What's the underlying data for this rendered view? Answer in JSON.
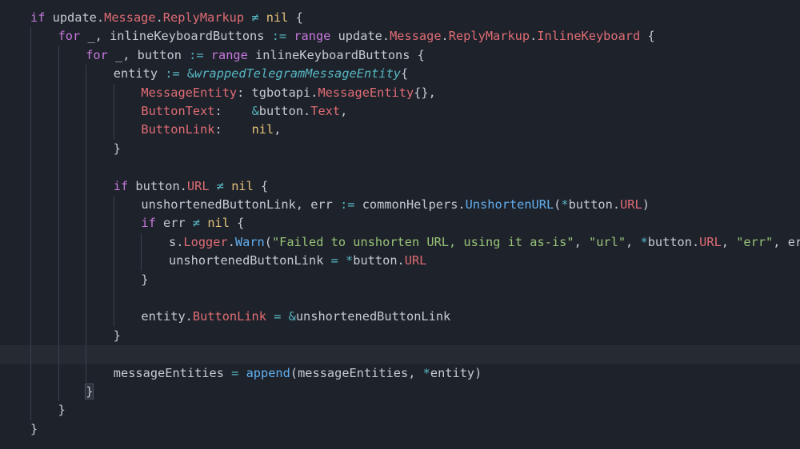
{
  "editor": {
    "lines": [
      {
        "indent": 0,
        "current": false,
        "tokens": [
          {
            "t": "if",
            "c": "kw"
          },
          {
            "t": " update.",
            "c": "nm"
          },
          {
            "t": "Message",
            "c": "ty"
          },
          {
            "t": ".",
            "c": "nm"
          },
          {
            "t": "ReplyMarkup",
            "c": "ty"
          },
          {
            "t": " ≠ ",
            "c": "op"
          },
          {
            "t": "nil",
            "c": "nl"
          },
          {
            "t": " {",
            "c": "pu"
          }
        ]
      },
      {
        "indent": 1,
        "current": false,
        "tokens": [
          {
            "t": "for",
            "c": "kw"
          },
          {
            "t": " _, inlineKeyboardButtons ",
            "c": "nm"
          },
          {
            "t": ":=",
            "c": "op"
          },
          {
            "t": " ",
            "c": "nm"
          },
          {
            "t": "range",
            "c": "kw"
          },
          {
            "t": " update.",
            "c": "nm"
          },
          {
            "t": "Message",
            "c": "ty"
          },
          {
            "t": ".",
            "c": "nm"
          },
          {
            "t": "ReplyMarkup",
            "c": "ty"
          },
          {
            "t": ".",
            "c": "nm"
          },
          {
            "t": "InlineKeyboard",
            "c": "ty"
          },
          {
            "t": " {",
            "c": "pu"
          }
        ]
      },
      {
        "indent": 2,
        "current": false,
        "tokens": [
          {
            "t": "for",
            "c": "kw"
          },
          {
            "t": " _, button ",
            "c": "nm"
          },
          {
            "t": ":=",
            "c": "op"
          },
          {
            "t": " ",
            "c": "nm"
          },
          {
            "t": "range",
            "c": "kw"
          },
          {
            "t": " inlineKeyboardButtons ",
            "c": "nm"
          },
          {
            "t": "{",
            "c": "pu"
          }
        ]
      },
      {
        "indent": 3,
        "current": false,
        "tokens": [
          {
            "t": "entity ",
            "c": "nm"
          },
          {
            "t": ":=",
            "c": "op"
          },
          {
            "t": " ",
            "c": "nm"
          },
          {
            "t": "&",
            "c": "op"
          },
          {
            "t": "wrappedTelegramMessageEntity",
            "c": "cl"
          },
          {
            "t": "{",
            "c": "pu"
          }
        ]
      },
      {
        "indent": 4,
        "current": false,
        "tokens": [
          {
            "t": "MessageEntity",
            "c": "ty"
          },
          {
            "t": ": tgbotapi.",
            "c": "nm"
          },
          {
            "t": "MessageEntity",
            "c": "ty"
          },
          {
            "t": "{},",
            "c": "pu"
          }
        ]
      },
      {
        "indent": 4,
        "current": false,
        "tokens": [
          {
            "t": "ButtonText",
            "c": "ty"
          },
          {
            "t": ":    ",
            "c": "nm"
          },
          {
            "t": "&",
            "c": "op"
          },
          {
            "t": "button.",
            "c": "nm"
          },
          {
            "t": "Text",
            "c": "ty"
          },
          {
            "t": ",",
            "c": "pu"
          }
        ]
      },
      {
        "indent": 4,
        "current": false,
        "tokens": [
          {
            "t": "ButtonLink",
            "c": "ty"
          },
          {
            "t": ":    ",
            "c": "nm"
          },
          {
            "t": "nil",
            "c": "nl"
          },
          {
            "t": ",",
            "c": "pu"
          }
        ]
      },
      {
        "indent": 3,
        "current": false,
        "tokens": [
          {
            "t": "}",
            "c": "pu"
          }
        ]
      },
      {
        "indent": 3,
        "current": false,
        "tokens": []
      },
      {
        "indent": 3,
        "current": false,
        "tokens": [
          {
            "t": "if",
            "c": "kw"
          },
          {
            "t": " button.",
            "c": "nm"
          },
          {
            "t": "URL",
            "c": "ty"
          },
          {
            "t": " ≠ ",
            "c": "op"
          },
          {
            "t": "nil",
            "c": "nl"
          },
          {
            "t": " {",
            "c": "pu"
          }
        ]
      },
      {
        "indent": 4,
        "current": false,
        "tokens": [
          {
            "t": "unshortenedButtonLink, err ",
            "c": "nm"
          },
          {
            "t": ":=",
            "c": "op"
          },
          {
            "t": " commonHelpers.",
            "c": "nm"
          },
          {
            "t": "UnshortenURL",
            "c": "fn"
          },
          {
            "t": "(",
            "c": "pu"
          },
          {
            "t": "*",
            "c": "op"
          },
          {
            "t": "button.",
            "c": "nm"
          },
          {
            "t": "URL",
            "c": "ty"
          },
          {
            "t": ")",
            "c": "pu"
          }
        ]
      },
      {
        "indent": 4,
        "current": false,
        "tokens": [
          {
            "t": "if",
            "c": "kw"
          },
          {
            "t": " err ",
            "c": "nm"
          },
          {
            "t": "≠",
            "c": "op"
          },
          {
            "t": " ",
            "c": "nm"
          },
          {
            "t": "nil",
            "c": "nl"
          },
          {
            "t": " {",
            "c": "pu"
          }
        ]
      },
      {
        "indent": 5,
        "current": false,
        "tokens": [
          {
            "t": "s.",
            "c": "nm"
          },
          {
            "t": "Logger",
            "c": "ty"
          },
          {
            "t": ".",
            "c": "nm"
          },
          {
            "t": "Warn",
            "c": "fn"
          },
          {
            "t": "(",
            "c": "pu"
          },
          {
            "t": "\"Failed to unshorten URL, using it as-is\"",
            "c": "st"
          },
          {
            "t": ", ",
            "c": "pu"
          },
          {
            "t": "\"url\"",
            "c": "st"
          },
          {
            "t": ", ",
            "c": "pu"
          },
          {
            "t": "*",
            "c": "op"
          },
          {
            "t": "button.",
            "c": "nm"
          },
          {
            "t": "URL",
            "c": "ty"
          },
          {
            "t": ", ",
            "c": "pu"
          },
          {
            "t": "\"err\"",
            "c": "st"
          },
          {
            "t": ", err)",
            "c": "pu"
          }
        ]
      },
      {
        "indent": 5,
        "current": false,
        "tokens": [
          {
            "t": "unshortenedButtonLink ",
            "c": "nm"
          },
          {
            "t": "=",
            "c": "op"
          },
          {
            "t": " ",
            "c": "nm"
          },
          {
            "t": "*",
            "c": "op"
          },
          {
            "t": "button.",
            "c": "nm"
          },
          {
            "t": "URL",
            "c": "ty"
          }
        ]
      },
      {
        "indent": 4,
        "current": false,
        "tokens": [
          {
            "t": "}",
            "c": "pu"
          }
        ]
      },
      {
        "indent": 4,
        "current": false,
        "tokens": []
      },
      {
        "indent": 4,
        "current": false,
        "tokens": [
          {
            "t": "entity.",
            "c": "nm"
          },
          {
            "t": "ButtonLink",
            "c": "ty"
          },
          {
            "t": " ",
            "c": "nm"
          },
          {
            "t": "=",
            "c": "op"
          },
          {
            "t": " ",
            "c": "nm"
          },
          {
            "t": "&",
            "c": "op"
          },
          {
            "t": "unshortenedButtonLink",
            "c": "nm"
          }
        ]
      },
      {
        "indent": 3,
        "current": false,
        "tokens": [
          {
            "t": "}",
            "c": "pu"
          }
        ]
      },
      {
        "indent": 3,
        "current": true,
        "tokens": []
      },
      {
        "indent": 3,
        "current": false,
        "tokens": [
          {
            "t": "messageEntities ",
            "c": "nm"
          },
          {
            "t": "=",
            "c": "op"
          },
          {
            "t": " ",
            "c": "nm"
          },
          {
            "t": "append",
            "c": "fn"
          },
          {
            "t": "(messageEntities, ",
            "c": "pu"
          },
          {
            "t": "*",
            "c": "op"
          },
          {
            "t": "entity)",
            "c": "pu"
          }
        ]
      },
      {
        "indent": 2,
        "current": false,
        "tokens": [
          {
            "t": "}",
            "c": "pu",
            "hl": true
          }
        ]
      },
      {
        "indent": 1,
        "current": false,
        "tokens": [
          {
            "t": "}",
            "c": "pu"
          }
        ]
      },
      {
        "indent": 0,
        "current": false,
        "tokens": [
          {
            "t": "}",
            "c": "pu"
          }
        ]
      }
    ]
  }
}
